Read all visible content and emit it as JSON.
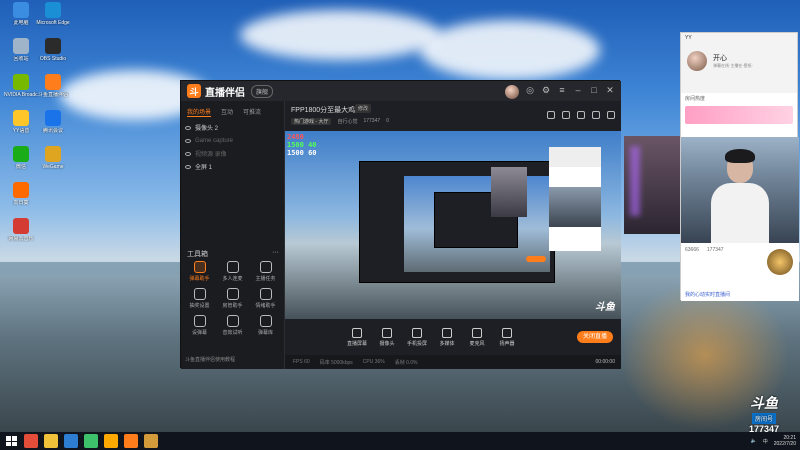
{
  "desktop": {
    "icons": [
      {
        "label": "此电脑",
        "color": "#3a8de0"
      },
      {
        "label": "Microsoft Edge",
        "color": "#1b8fd6"
      },
      {
        "label": "回收站",
        "color": "#9fb4c8"
      },
      {
        "label": "OBS Studio",
        "color": "#2b2b2b"
      },
      {
        "label": "NVIDIA Broadcast",
        "color": "#76b900"
      },
      {
        "label": "斗鱼直播伴侣",
        "color": "#ff7d1a"
      },
      {
        "label": "YY语音",
        "color": "#ffc629"
      },
      {
        "label": "腾讯会议",
        "color": "#1a73e8"
      },
      {
        "label": "微信",
        "color": "#1aad19"
      },
      {
        "label": "WeGame",
        "color": "#e0a520"
      },
      {
        "label": "向日葵",
        "color": "#ff6a00"
      },
      {
        "label": "网易云音乐",
        "color": "#d43c33"
      }
    ]
  },
  "app": {
    "logo_glyph": "斗",
    "name": "直播伴侣",
    "version": "旗舰",
    "tabs": [
      "我的场景",
      "互动",
      "可推流"
    ],
    "scenes": [
      {
        "label": "摄像头 2",
        "dim": false
      },
      {
        "label": "Game capture",
        "dim": true
      },
      {
        "label": "视频源 录像",
        "dim": true
      },
      {
        "label": "全屏 1",
        "dim": false
      }
    ],
    "tools_title": "工具箱",
    "tools_more": "···",
    "tools": [
      {
        "label": "弹幕助手",
        "hot": true
      },
      {
        "label": "多人连麦",
        "hot": false
      },
      {
        "label": "主播任务",
        "hot": false
      },
      {
        "label": "抽奖设置",
        "hot": false
      },
      {
        "label": "房管助手",
        "hot": false
      },
      {
        "label": "情绪助手",
        "hot": false
      },
      {
        "label": "设弹幕",
        "hot": false
      },
      {
        "label": "音效试听",
        "hot": false
      },
      {
        "label": "弹幕库",
        "hot": false
      }
    ],
    "left_footer": "斗鱼直播伴侣使用教程",
    "room": {
      "title": "FPP1800分至最大鸡局",
      "tag": "修改",
      "category": "热门游戏 - 大厅",
      "owner": "自行心觉",
      "id": "177347",
      "fans": "0"
    },
    "stats_lines": [
      {
        "text": "2480",
        "color": "#ff5555"
      },
      {
        "text": "1500 40",
        "color": "#55ff55"
      },
      {
        "text": "1500 60",
        "color": "#ffffff"
      }
    ],
    "preview_tag": "斗鱼",
    "controls": [
      {
        "label": "直播屏幕"
      },
      {
        "label": "摄像头"
      },
      {
        "label": "手机投屏"
      },
      {
        "label": "多媒体"
      },
      {
        "label": "麦克风"
      },
      {
        "label": "扬声器"
      }
    ],
    "live_button": "关闭直播",
    "status": {
      "fps": "FPS 60",
      "bitrate": "码率 5000kbps",
      "cpu": "CPU 36%",
      "drop": "丢帧 0.0%",
      "time": "00:00:00"
    }
  },
  "chat": {
    "app": "YY",
    "streamer_name": "开心",
    "streamer_sub": "弹幕在线·主播在·壁纸·",
    "room_label": "房间热度",
    "fans_count": "63666",
    "viewer_count": "177347",
    "footer": "我的心动实时直播间"
  },
  "badge": {
    "logo": "斗鱼",
    "label": "房间号",
    "room_number": "177347"
  },
  "taskbar": {
    "apps": [
      {
        "name": "chrome-icon",
        "color": "#e44d3a"
      },
      {
        "name": "folder-icon",
        "color": "#f0c23a"
      },
      {
        "name": "terminal-icon",
        "color": "#2d7dd2"
      },
      {
        "name": "play-icon",
        "color": "#3ec16b"
      },
      {
        "name": "media-icon",
        "color": "#ffa800"
      },
      {
        "name": "douyu-icon",
        "color": "#ff7d1a"
      },
      {
        "name": "box-icon",
        "color": "#d49b3a"
      }
    ],
    "time": "20:21",
    "date": "2022/7/20",
    "lang": "中"
  }
}
